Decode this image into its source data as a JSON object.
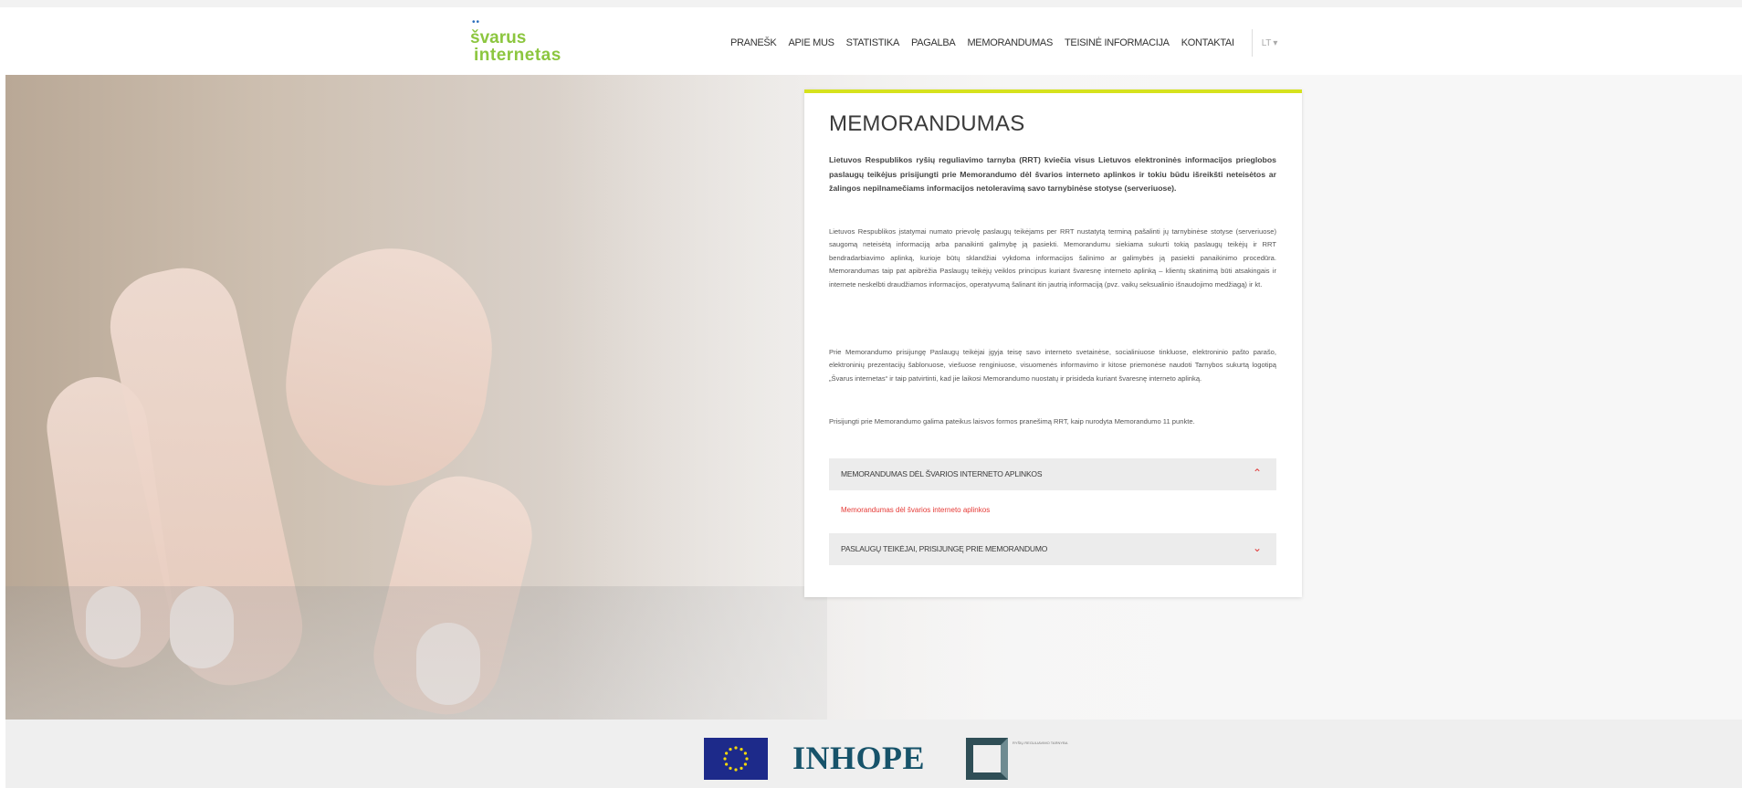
{
  "header": {
    "logo": {
      "line1": "švarus",
      "line2": "internetas"
    },
    "nav": [
      "PRANEŠK",
      "APIE MUS",
      "STATISTIKA",
      "PAGALBA",
      "MEMORANDUMAS",
      "TEISINĖ INFORMACIJA",
      "KONTAKTAI"
    ],
    "language": "LT ▾"
  },
  "article": {
    "title": "MEMORANDUMAS",
    "lead": "Lietuvos Respublikos ryšių reguliavimo tarnyba (RRT) kviečia visus Lietuvos elektroninės informacijos prieglobos paslaugų teikėjus prisijungti prie Memorandumo dėl švarios interneto aplinkos ir tokiu būdu išreikšti neteisėtos ar žalingos nepilnamečiams informacijos netoleravimą savo tarnybinėse stotyse (serveriuose).",
    "paragraph1": "Lietuvos Respublikos įstatymai numato prievolę paslaugų teikėjams per RRT nustatytą terminą pašalinti jų tarnybinėse stotyse (serveriuose) saugomą neteisėtą informaciją arba panaikinti galimybę ją pasiekti. Memorandumu siekiama sukurti tokią paslaugų teikėjų ir RRT bendradarbiavimo aplinką, kurioje būtų sklandžiai vykdoma informacijos šalinimo ar galimybės ją pasiekti panaikinimo procedūra. Memorandumas taip pat apibrėžia Paslaugų teikėjų veiklos principus kuriant švaresnę interneto aplinką – klientų skatinimą būti atsakingais ir internete neskelbti draudžiamos informacijos, operatyvumą šalinant itin jautrią informaciją (pvz. vaikų seksualinio išnaudojimo medžiagą) ir kt.",
    "paragraph2": "Prie Memorandumo prisijungę Paslaugų teikėjai įgyja teisę savo interneto svetainėse, socialiniuose tinkluose, elektroninio pašto parašo, elektroninių prezentacijų šablonuose, viešuose renginiuose, visuomenės informavimo ir kitose priemonėse naudoti Tarnybos sukurtą logotipą „Švarus internetas“ ir taip patvirtinti, kad jie laikosi Memorandumo nuostatų ir prisideda kuriant švaresnę interneto aplinką.",
    "paragraph3": "Prisijungti prie Memorandumo galima pateikus laisvos formos pranešimą RRT, kaip nurodyta Memorandumo 11 punkte.",
    "accordion": [
      {
        "title": "MEMORANDUMAS DĖL ŠVARIOS INTERNETO APLINKOS",
        "expanded": true,
        "link": "Memorandumas dėl švarios interneto aplinkos"
      },
      {
        "title": "PASLAUGŲ TEIKĖJAI, PRISIJUNGĘ PRIE MEMORANDUMO",
        "expanded": false
      }
    ]
  },
  "footer": {
    "logos": [
      "eu-flag",
      "INHOPE",
      "rrt-logo"
    ],
    "inhope_text": "INHOPE",
    "rrt_caption": "RYŠIŲ REGULIAVIMO TARNYBA"
  },
  "colors": {
    "brand_green": "#8cc63f",
    "accent_yellow": "#d6e21d",
    "link_red": "#e53935",
    "inhope_blue": "#17536a"
  }
}
